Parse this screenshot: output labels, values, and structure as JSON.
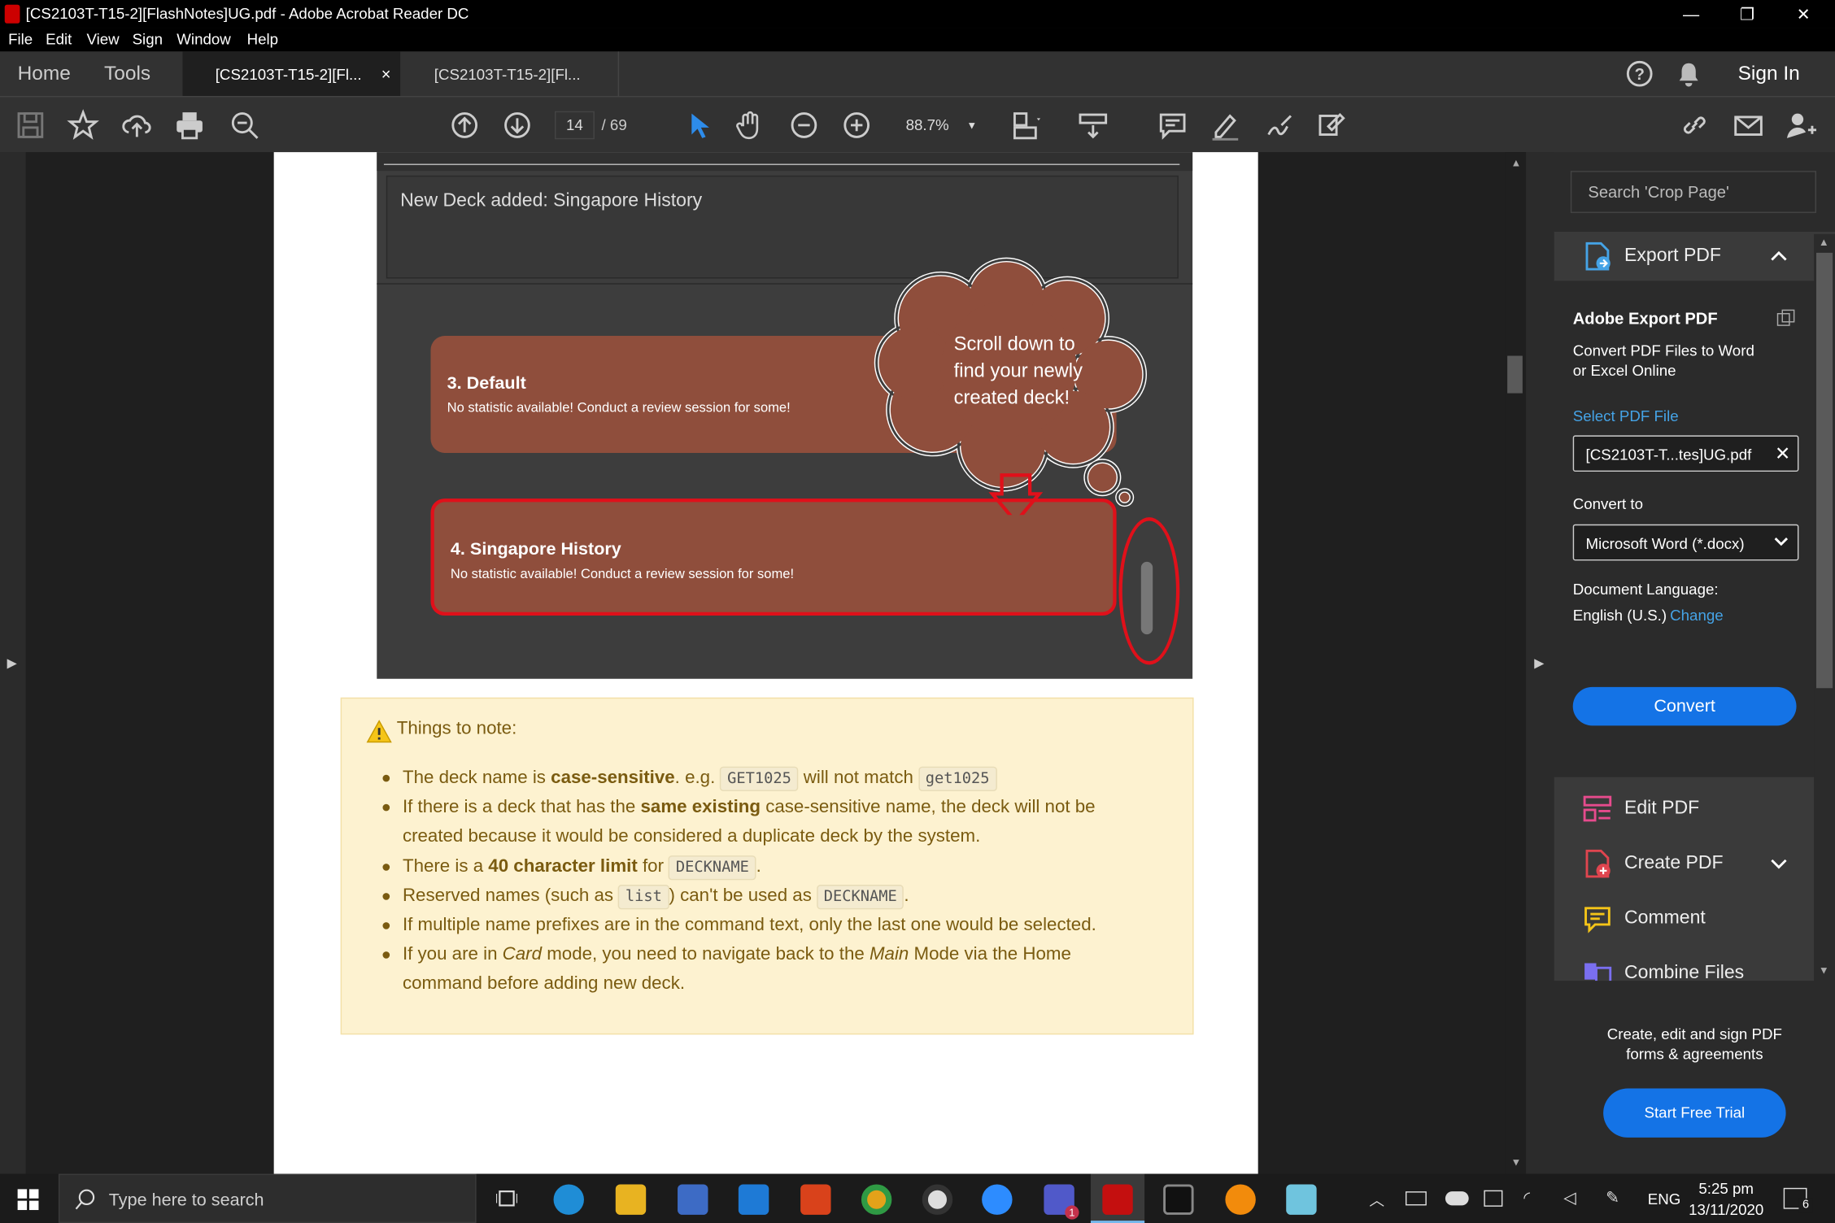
{
  "window": {
    "title": "[CS2103T-T15-2][FlashNotes]UG.pdf - Adobe Acrobat Reader DC"
  },
  "menu": [
    "File",
    "Edit",
    "View",
    "Sign",
    "Window",
    "Help"
  ],
  "tabs": {
    "home": "Home",
    "tools": "Tools",
    "doc1": "[CS2103T-T15-2][Fl...",
    "doc2": "[CS2103T-T15-2][Fl...",
    "close": "×",
    "signin": "Sign In"
  },
  "toolbar": {
    "page_current": "14",
    "page_total": "/ 69",
    "zoom": "88.7%"
  },
  "app_screenshot": {
    "result_text": "New Deck added: Singapore History",
    "cards": [
      {
        "title": "3.  Default",
        "subtitle": "No statistic available! Conduct a review session for some!"
      },
      {
        "title": "4.  Singapore History",
        "subtitle": "No statistic available! Conduct a review session for some!"
      }
    ],
    "callout": [
      "Scroll down to",
      "find your newly",
      "created deck!"
    ]
  },
  "note": {
    "heading": "Things to note:",
    "items": [
      {
        "t1": "The deck name is ",
        "b": "case-sensitive",
        "t2": ". e.g. ",
        "c1": "GET1025",
        "t3": " will not match ",
        "c2": "get1025"
      },
      {
        "t1": "If there is a deck that has the ",
        "b": "same existing",
        "t2": " case-sensitive name, the deck will not be",
        "line2": "created because it would be considered a duplicate deck by the system."
      },
      {
        "t1": "There is a ",
        "b": "40 character limit",
        "t2": " for ",
        "c1": "DECKNAME",
        "t3": "."
      },
      {
        "t1": "Reserved names (such as ",
        "c1": "list",
        "t2": ") can't be used as ",
        "c2": "DECKNAME",
        "t3": "."
      },
      {
        "t1": "If multiple name prefixes are in the command text, only the last one would be selected."
      },
      {
        "t1": "If you are in ",
        "i1": "Card",
        "t2": " mode, you need to navigate back to the ",
        "i2": "Main",
        "t3": " Mode via the Home",
        "line2": "command before adding new deck."
      }
    ]
  },
  "sidebar": {
    "search_placeholder": "Search 'Crop Page'",
    "export_title": "Export PDF",
    "adobe_export": "Adobe Export PDF",
    "convert_desc1": "Convert PDF Files to Word",
    "convert_desc2": "or Excel Online",
    "select_file": "Select PDF File",
    "file_value": "[CS2103T-T...tes]UG.pdf",
    "convert_to": "Convert to",
    "format": "Microsoft Word (*.docx)",
    "doc_lang": "Document Language:",
    "lang": "English (U.S.)",
    "change": "Change",
    "convert_btn": "Convert",
    "tools": [
      "Edit PDF",
      "Create PDF",
      "Comment",
      "Combine Files"
    ],
    "promo1": "Create, edit and sign PDF",
    "promo2": "forms & agreements",
    "trial_btn": "Start Free Trial"
  },
  "taskbar": {
    "search": "Type here to search",
    "lang": "ENG",
    "time": "5:25 pm",
    "date": "13/11/2020",
    "notif_count": "6",
    "teams_badge": "1"
  },
  "colors": {
    "accent": "#1473e6",
    "card": "#8f4e3c",
    "highlight": "#e0101a",
    "note_bg": "#fdf2d0"
  }
}
